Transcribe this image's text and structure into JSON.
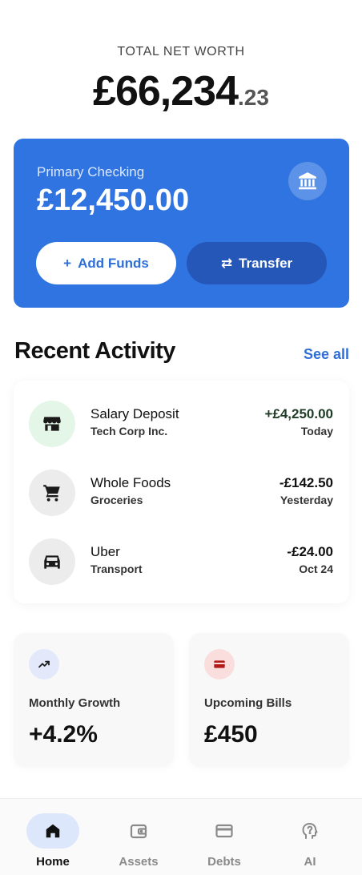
{
  "networth": {
    "label": "TOTAL NET WORTH",
    "whole": "£66,234",
    "fraction": ".23"
  },
  "checking": {
    "label": "Primary Checking",
    "balance": "£12,450.00",
    "icon": "bank-icon",
    "add_funds": {
      "icon": "+",
      "label": "Add Funds"
    },
    "transfer": {
      "icon": "⇄",
      "label": "Transfer"
    }
  },
  "recent": {
    "title": "Recent Activity",
    "see_all": "See all",
    "items": [
      {
        "name": "Salary Deposit",
        "category": "Tech Corp Inc.",
        "amount": "+£4,250.00",
        "date": "Today",
        "icon": "store-icon",
        "icon_bg": "#e4f6e7"
      },
      {
        "name": "Whole Foods",
        "category": "Groceries",
        "amount": "-£142.50",
        "date": "Yesterday",
        "icon": "cart-icon",
        "icon_bg": "#ececec"
      },
      {
        "name": "Uber",
        "category": "Transport",
        "amount": "-£24.00",
        "date": "Oct 24",
        "icon": "car-icon",
        "icon_bg": "#ececec"
      }
    ]
  },
  "stats": {
    "growth": {
      "label": "Monthly Growth",
      "value": "+4.2%",
      "icon": "trending-up-icon",
      "icon_bg": "#e3e9fb"
    },
    "bills": {
      "label": "Upcoming Bills",
      "value": "£450",
      "icon": "card-icon",
      "icon_bg": "#fadede"
    }
  },
  "nav": {
    "items": [
      {
        "label": "Home",
        "icon": "home-icon",
        "active": true
      },
      {
        "label": "Assets",
        "icon": "wallet-icon",
        "active": false
      },
      {
        "label": "Debts",
        "icon": "credit-card-icon",
        "active": false
      },
      {
        "label": "AI",
        "icon": "brain-icon",
        "active": false
      }
    ]
  },
  "colors": {
    "accent": "#2f74e0",
    "accent_dark": "#2457b8",
    "link": "#2f6fd6",
    "positive_text": "#1d3b25",
    "bills_red": "#b31b1b"
  }
}
